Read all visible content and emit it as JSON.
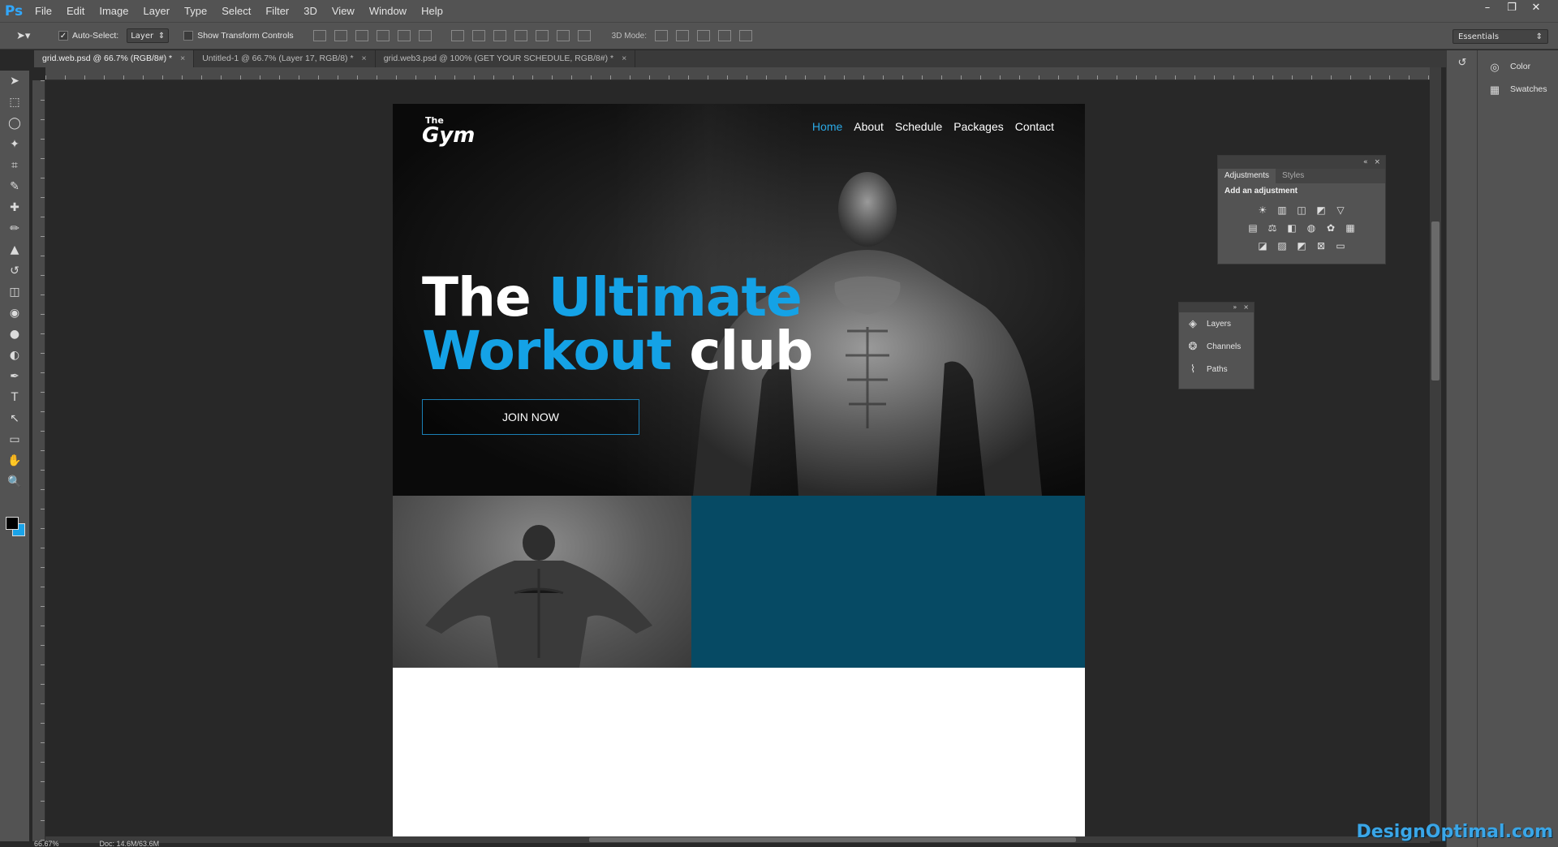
{
  "app": {
    "logo": "Ps"
  },
  "menu": [
    "File",
    "Edit",
    "Image",
    "Layer",
    "Type",
    "Select",
    "Filter",
    "3D",
    "View",
    "Window",
    "Help"
  ],
  "window_controls": [
    "–",
    "❐",
    "✕"
  ],
  "options": {
    "auto_select_label": "Auto-Select:",
    "auto_select_value": "Layer",
    "transform_label": "Show Transform Controls",
    "mode_3d_label": "3D Mode:",
    "workspace": "Essentials"
  },
  "tabs": [
    {
      "label": "grid.web.psd @ 66.7% (RGB/8#) *",
      "close": "×"
    },
    {
      "label": "Untitled-1 @ 66.7% (Layer 17, RGB/8) *",
      "close": "×"
    },
    {
      "label": "grid.web3.psd @ 100% (GET YOUR SCHEDULE, RGB/8#) *",
      "close": "×"
    }
  ],
  "tools": [
    "move-tool",
    "marquee-tool",
    "lasso-tool",
    "magic-wand-tool",
    "crop-tool",
    "eyedropper-tool",
    "healing-tool",
    "brush-tool",
    "stamp-tool",
    "history-brush-tool",
    "eraser-tool",
    "paint-bucket-tool",
    "blur-tool",
    "dodge-tool",
    "pen-tool",
    "type-tool",
    "path-select-tool",
    "shape-tool",
    "hand-tool",
    "zoom-tool"
  ],
  "tool_glyphs": [
    "➤",
    "⬚",
    "◯",
    "✦",
    "⌗",
    "✎",
    "✚",
    "✏",
    "▲",
    "↺",
    "◫",
    "◉",
    "●",
    "◐",
    "✒",
    "T",
    "↖",
    "▭",
    "✋",
    "🔍"
  ],
  "colors": {
    "foreground": "#000000",
    "background": "#1aa3e8",
    "accent": "#14a2e6",
    "teal": "#064a64"
  },
  "design": {
    "logo_small": "The",
    "logo_big": "Gym",
    "nav": [
      "Home",
      "About",
      "Schedule",
      "Packages",
      "Contact"
    ],
    "nav_active": "Home",
    "headline_word1": "The",
    "headline_word2": "Ultimate",
    "headline_word3": "Workout",
    "headline_word4": "club",
    "cta": "JOIN NOW"
  },
  "right_dock": {
    "items": [
      {
        "label": "Color",
        "icon": "color-icon"
      },
      {
        "label": "Swatches",
        "icon": "swatches-icon"
      }
    ]
  },
  "adjustments": {
    "tabs": [
      "Adjustments",
      "Styles"
    ],
    "title": "Add an adjustment",
    "head_glyphs": [
      "«",
      "×"
    ]
  },
  "layers_panel": {
    "items": [
      {
        "label": "Layers",
        "icon": "layers-icon"
      },
      {
        "label": "Channels",
        "icon": "channels-icon"
      },
      {
        "label": "Paths",
        "icon": "paths-icon"
      }
    ],
    "head_glyphs": [
      "»",
      "×"
    ]
  },
  "status": {
    "zoom": "66.67%",
    "doc": "Doc: 14.6M/63.6M"
  },
  "watermark": "DesignOptimal.com"
}
